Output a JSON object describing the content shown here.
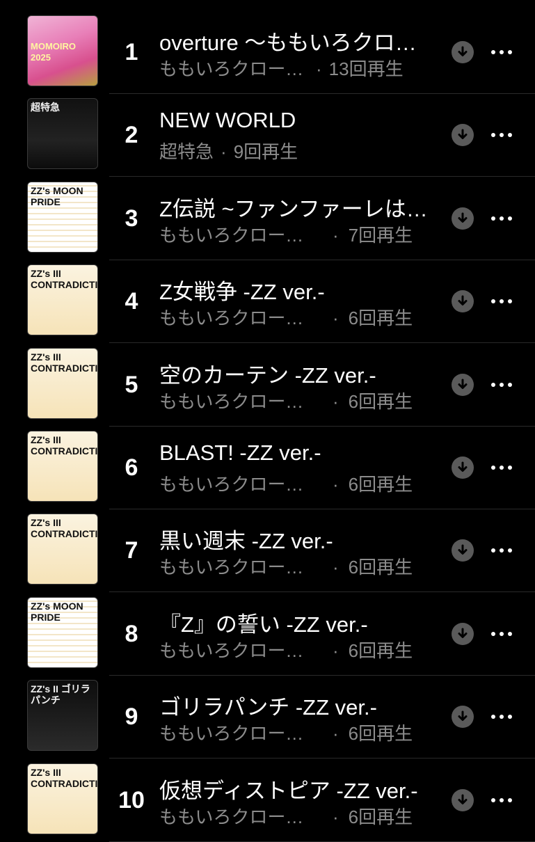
{
  "tracks": [
    {
      "rank": "1",
      "title": "overture 〜ももいろクローバーZ参上!!〜",
      "artist": "ももいろクローバーZ",
      "plays": "13回再生",
      "art": "art-pink",
      "art_text": "MOMOIRO 2025",
      "gap": false
    },
    {
      "rank": "2",
      "title": "NEW WORLD",
      "artist": "超特急",
      "plays": "9回再生",
      "art": "art-dark",
      "art_text": "超特急",
      "gap": false
    },
    {
      "rank": "3",
      "title": "Z伝説 ~ファンファーレは止まらない~",
      "artist": "ももいろクローバーZ",
      "plays": "7回再生",
      "art": "art-zz1",
      "art_text": "ZZ's MOON PRIDE",
      "gap": true
    },
    {
      "rank": "4",
      "title": "Z女戦争 -ZZ ver.-",
      "artist": "ももいろクローバーZ",
      "plays": "6回再生",
      "art": "art-zz3",
      "art_text": "ZZ's III CONTRADICTION",
      "gap": true
    },
    {
      "rank": "5",
      "title": "空のカーテン -ZZ ver.-",
      "artist": "ももいろクローバーZ",
      "plays": "6回再生",
      "art": "art-zz3",
      "art_text": "ZZ's III CONTRADICTION",
      "gap": true
    },
    {
      "rank": "6",
      "title": "BLAST! -ZZ ver.-",
      "artist": "ももいろクローバーZ",
      "plays": "6回再生",
      "art": "art-zz3",
      "art_text": "ZZ's III CONTRADICTION",
      "gap": true
    },
    {
      "rank": "7",
      "title": "黒い週末 -ZZ ver.-",
      "artist": "ももいろクローバーZ",
      "plays": "6回再生",
      "art": "art-zz3",
      "art_text": "ZZ's III CONTRADICTION",
      "gap": true
    },
    {
      "rank": "8",
      "title": "『Z』の誓い -ZZ ver.-",
      "artist": "ももいろクローバーZ",
      "plays": "6回再生",
      "art": "art-zz1",
      "art_text": "ZZ's MOON PRIDE",
      "gap": true
    },
    {
      "rank": "9",
      "title": "ゴリラパンチ -ZZ ver.-",
      "artist": "ももいろクローバーZ",
      "plays": "6回再生",
      "art": "art-zz2",
      "art_text": "ZZ's II ゴリラパンチ",
      "gap": true
    },
    {
      "rank": "10",
      "title": "仮想ディストピア -ZZ ver.-",
      "artist": "ももいろクローバーZ",
      "plays": "6回再生",
      "art": "art-zz3",
      "art_text": "ZZ's III CONTRADICTION",
      "gap": true
    }
  ]
}
